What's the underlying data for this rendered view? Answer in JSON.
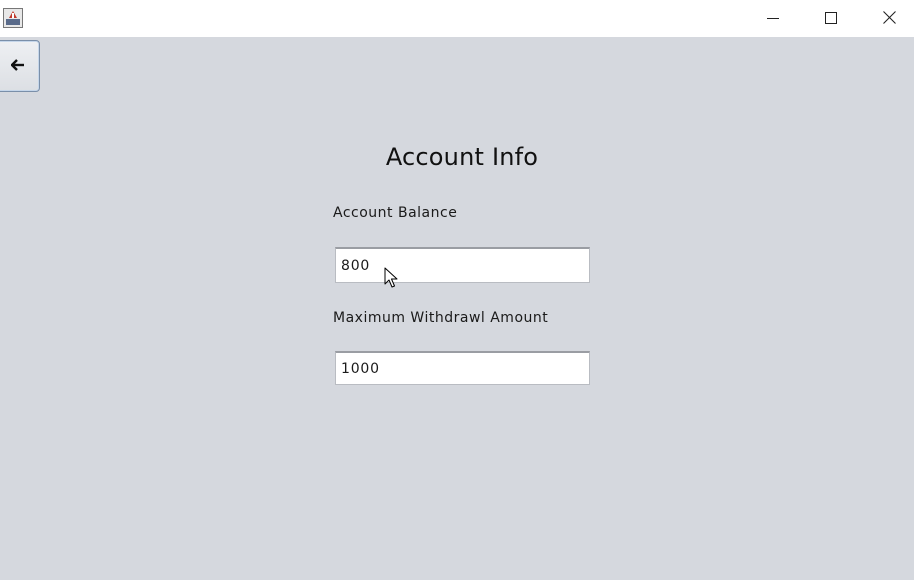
{
  "window": {
    "app_icon": "java-app-icon",
    "controls": {
      "minimize_icon": "minimize-icon",
      "maximize_icon": "maximize-icon",
      "close_icon": "close-icon"
    }
  },
  "toolbar": {
    "back_icon": "arrow-left-icon"
  },
  "form": {
    "title": "Account Info",
    "fields": [
      {
        "label": "Account Balance",
        "value": "800"
      },
      {
        "label": "Maximum Withdrawl Amount",
        "value": "1000"
      }
    ]
  },
  "colors": {
    "background": "#d5d8de",
    "titlebar": "#ffffff",
    "field_background": "#ffffff",
    "button_border": "#7a8fa9"
  }
}
